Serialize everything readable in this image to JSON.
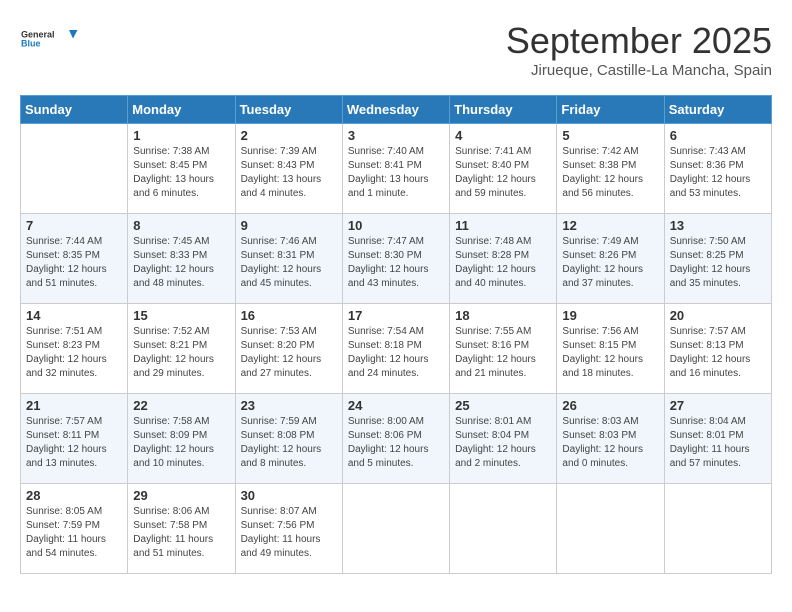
{
  "header": {
    "logo_line1": "General",
    "logo_line2": "Blue",
    "month": "September 2025",
    "location": "Jirueque, Castille-La Mancha, Spain"
  },
  "weekdays": [
    "Sunday",
    "Monday",
    "Tuesday",
    "Wednesday",
    "Thursday",
    "Friday",
    "Saturday"
  ],
  "weeks": [
    [
      {
        "day": "",
        "info": ""
      },
      {
        "day": "1",
        "info": "Sunrise: 7:38 AM\nSunset: 8:45 PM\nDaylight: 13 hours\nand 6 minutes."
      },
      {
        "day": "2",
        "info": "Sunrise: 7:39 AM\nSunset: 8:43 PM\nDaylight: 13 hours\nand 4 minutes."
      },
      {
        "day": "3",
        "info": "Sunrise: 7:40 AM\nSunset: 8:41 PM\nDaylight: 13 hours\nand 1 minute."
      },
      {
        "day": "4",
        "info": "Sunrise: 7:41 AM\nSunset: 8:40 PM\nDaylight: 12 hours\nand 59 minutes."
      },
      {
        "day": "5",
        "info": "Sunrise: 7:42 AM\nSunset: 8:38 PM\nDaylight: 12 hours\nand 56 minutes."
      },
      {
        "day": "6",
        "info": "Sunrise: 7:43 AM\nSunset: 8:36 PM\nDaylight: 12 hours\nand 53 minutes."
      }
    ],
    [
      {
        "day": "7",
        "info": "Sunrise: 7:44 AM\nSunset: 8:35 PM\nDaylight: 12 hours\nand 51 minutes."
      },
      {
        "day": "8",
        "info": "Sunrise: 7:45 AM\nSunset: 8:33 PM\nDaylight: 12 hours\nand 48 minutes."
      },
      {
        "day": "9",
        "info": "Sunrise: 7:46 AM\nSunset: 8:31 PM\nDaylight: 12 hours\nand 45 minutes."
      },
      {
        "day": "10",
        "info": "Sunrise: 7:47 AM\nSunset: 8:30 PM\nDaylight: 12 hours\nand 43 minutes."
      },
      {
        "day": "11",
        "info": "Sunrise: 7:48 AM\nSunset: 8:28 PM\nDaylight: 12 hours\nand 40 minutes."
      },
      {
        "day": "12",
        "info": "Sunrise: 7:49 AM\nSunset: 8:26 PM\nDaylight: 12 hours\nand 37 minutes."
      },
      {
        "day": "13",
        "info": "Sunrise: 7:50 AM\nSunset: 8:25 PM\nDaylight: 12 hours\nand 35 minutes."
      }
    ],
    [
      {
        "day": "14",
        "info": "Sunrise: 7:51 AM\nSunset: 8:23 PM\nDaylight: 12 hours\nand 32 minutes."
      },
      {
        "day": "15",
        "info": "Sunrise: 7:52 AM\nSunset: 8:21 PM\nDaylight: 12 hours\nand 29 minutes."
      },
      {
        "day": "16",
        "info": "Sunrise: 7:53 AM\nSunset: 8:20 PM\nDaylight: 12 hours\nand 27 minutes."
      },
      {
        "day": "17",
        "info": "Sunrise: 7:54 AM\nSunset: 8:18 PM\nDaylight: 12 hours\nand 24 minutes."
      },
      {
        "day": "18",
        "info": "Sunrise: 7:55 AM\nSunset: 8:16 PM\nDaylight: 12 hours\nand 21 minutes."
      },
      {
        "day": "19",
        "info": "Sunrise: 7:56 AM\nSunset: 8:15 PM\nDaylight: 12 hours\nand 18 minutes."
      },
      {
        "day": "20",
        "info": "Sunrise: 7:57 AM\nSunset: 8:13 PM\nDaylight: 12 hours\nand 16 minutes."
      }
    ],
    [
      {
        "day": "21",
        "info": "Sunrise: 7:57 AM\nSunset: 8:11 PM\nDaylight: 12 hours\nand 13 minutes."
      },
      {
        "day": "22",
        "info": "Sunrise: 7:58 AM\nSunset: 8:09 PM\nDaylight: 12 hours\nand 10 minutes."
      },
      {
        "day": "23",
        "info": "Sunrise: 7:59 AM\nSunset: 8:08 PM\nDaylight: 12 hours\nand 8 minutes."
      },
      {
        "day": "24",
        "info": "Sunrise: 8:00 AM\nSunset: 8:06 PM\nDaylight: 12 hours\nand 5 minutes."
      },
      {
        "day": "25",
        "info": "Sunrise: 8:01 AM\nSunset: 8:04 PM\nDaylight: 12 hours\nand 2 minutes."
      },
      {
        "day": "26",
        "info": "Sunrise: 8:03 AM\nSunset: 8:03 PM\nDaylight: 12 hours\nand 0 minutes."
      },
      {
        "day": "27",
        "info": "Sunrise: 8:04 AM\nSunset: 8:01 PM\nDaylight: 11 hours\nand 57 minutes."
      }
    ],
    [
      {
        "day": "28",
        "info": "Sunrise: 8:05 AM\nSunset: 7:59 PM\nDaylight: 11 hours\nand 54 minutes."
      },
      {
        "day": "29",
        "info": "Sunrise: 8:06 AM\nSunset: 7:58 PM\nDaylight: 11 hours\nand 51 minutes."
      },
      {
        "day": "30",
        "info": "Sunrise: 8:07 AM\nSunset: 7:56 PM\nDaylight: 11 hours\nand 49 minutes."
      },
      {
        "day": "",
        "info": ""
      },
      {
        "day": "",
        "info": ""
      },
      {
        "day": "",
        "info": ""
      },
      {
        "day": "",
        "info": ""
      }
    ]
  ]
}
